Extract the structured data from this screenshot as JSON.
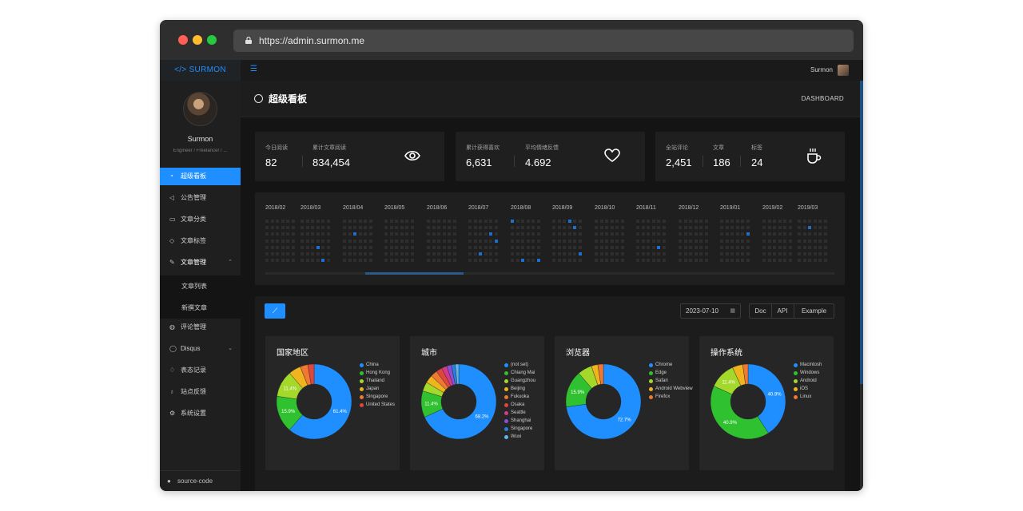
{
  "browser": {
    "url": "https://admin.surmon.me",
    "dots": [
      "#ff5f57",
      "#febc2e",
      "#28c840"
    ]
  },
  "sidebar": {
    "logo": "</> SURMON",
    "user_name": "Surmon",
    "user_slogan": "Engineer / Freelancer / ...",
    "items": [
      {
        "label": "超级看板",
        "icon": "dashboard-icon",
        "active": true
      },
      {
        "label": "公告管理",
        "icon": "megaphone-icon"
      },
      {
        "label": "文章分类",
        "icon": "folder-icon"
      },
      {
        "label": "文章标签",
        "icon": "tag-icon"
      },
      {
        "label": "文章管理",
        "icon": "edit-icon",
        "expanded": true
      },
      {
        "label": "文章列表",
        "sub": true
      },
      {
        "label": "新撰文章",
        "sub": true
      },
      {
        "label": "评论管理",
        "icon": "comment-icon"
      },
      {
        "label": "Disqus",
        "icon": "disqus-icon",
        "collapsed": true
      },
      {
        "label": "表态记录",
        "icon": "like-icon"
      },
      {
        "label": "站点反馈",
        "icon": "bulb-icon"
      },
      {
        "label": "系统设置",
        "icon": "gear-icon"
      }
    ],
    "source_code": "source-code"
  },
  "topbar": {
    "user": "Surmon"
  },
  "header": {
    "title": "超级看板",
    "subtitle": "DASHBOARD"
  },
  "stats": [
    {
      "items": [
        {
          "label": "今日阅读",
          "value": "82"
        },
        {
          "label": "累计文章阅读",
          "value": "834,454"
        }
      ],
      "icon": "eye-icon"
    },
    {
      "items": [
        {
          "label": "累计获得喜欢",
          "value": "6,631"
        },
        {
          "label": "平均情绪反馈",
          "value": "4.692"
        }
      ],
      "icon": "heart-icon"
    },
    {
      "items": [
        {
          "label": "全站评论",
          "value": "2,451"
        },
        {
          "label": "文章",
          "value": "186"
        },
        {
          "label": "标签",
          "value": "24"
        }
      ],
      "icon": "coffee-icon"
    }
  ],
  "calendar": {
    "months": [
      "2018/02",
      "2018/03",
      "2018/04",
      "2018/05",
      "2018/06",
      "2018/07",
      "2018/08",
      "2018/09",
      "2018/10",
      "2018/11",
      "2018/12",
      "2019/01",
      "2019/02",
      "2019/03"
    ]
  },
  "analytics": {
    "date": "2023-07-10",
    "segments": [
      "Doc",
      "API",
      "Example"
    ]
  },
  "chart_data": [
    {
      "type": "pie",
      "title": "国家地区",
      "categories": [
        "China",
        "Hong Kong",
        "Thailand",
        "Japan",
        "Singapore",
        "United States"
      ],
      "values": [
        61.4,
        15.9,
        11.4,
        5.3,
        3.3,
        2.7
      ],
      "labels": [
        "61.4%",
        "15.9%",
        "11.4%"
      ],
      "colors": [
        "#1f8fff",
        "#2fc12f",
        "#a4d82a",
        "#f0b41e",
        "#f07832",
        "#e0463c"
      ]
    },
    {
      "type": "pie",
      "title": "城市",
      "categories": [
        "(not set)",
        "Chiang Mai",
        "Guangzhou",
        "Beijing",
        "Fukuoka",
        "Osaka",
        "Seattle",
        "Shanghai",
        "Singapore",
        "Wuxi"
      ],
      "values": [
        68.2,
        11.4,
        4.0,
        3.4,
        2.9,
        2.6,
        2.3,
        2.0,
        1.7,
        1.5
      ],
      "labels": [
        "68.2%",
        "11.4%"
      ],
      "colors": [
        "#1f8fff",
        "#2fc12f",
        "#a4d82a",
        "#f0b41e",
        "#f07832",
        "#e0463c",
        "#d43a8c",
        "#8a4fd6",
        "#2a7fd6",
        "#5cb8ef"
      ]
    },
    {
      "type": "pie",
      "title": "浏览器",
      "categories": [
        "Chrome",
        "Edge",
        "Safari",
        "Android Webview",
        "Firefox"
      ],
      "values": [
        72.7,
        15.9,
        6.2,
        2.8,
        2.4
      ],
      "labels": [
        "72.7%",
        "15.9%"
      ],
      "colors": [
        "#1f8fff",
        "#2fc12f",
        "#a4d82a",
        "#f0b41e",
        "#f07832"
      ]
    },
    {
      "type": "pie",
      "title": "操作系统",
      "categories": [
        "Macintosh",
        "Windows",
        "Android",
        "iOS",
        "Linux"
      ],
      "values": [
        40.9,
        40.9,
        11.4,
        4.5,
        2.3
      ],
      "labels": [
        "40.9%",
        "40.9%",
        "11.4%"
      ],
      "colors": [
        "#1f8fff",
        "#2fc12f",
        "#a4d82a",
        "#f0b41e",
        "#f07832"
      ]
    }
  ]
}
